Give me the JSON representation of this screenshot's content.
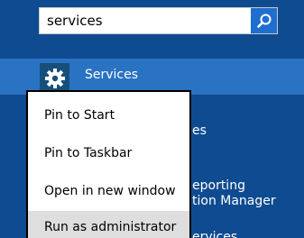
{
  "search": {
    "value": "services",
    "button_icon": "search-icon"
  },
  "selected_result": {
    "label": "Services",
    "icon": "gear-icon"
  },
  "background_results": {
    "item1_partial": "es",
    "item2_line1_partial": "eporting",
    "item2_line2_partial": "tion Manager",
    "item3_partial": "ervices"
  },
  "context_menu": {
    "items": [
      {
        "label": "Pin to Start"
      },
      {
        "label": "Pin to Taskbar"
      },
      {
        "label": "Open in new window"
      },
      {
        "label": "Run as administrator"
      }
    ]
  },
  "colors": {
    "background": "#0f4b90",
    "selected_row": "#2a72c2",
    "search_button": "#1f6fd0",
    "menu_hover": "#dedede"
  }
}
